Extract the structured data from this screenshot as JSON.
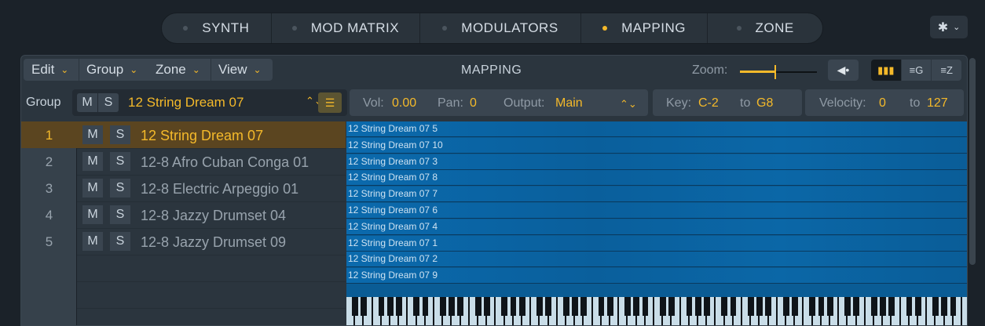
{
  "nav": {
    "tabs": [
      {
        "label": "SYNTH",
        "active": false
      },
      {
        "label": "MOD MATRIX",
        "active": false
      },
      {
        "label": "MODULATORS",
        "active": false
      },
      {
        "label": "MAPPING",
        "active": true
      },
      {
        "label": "ZONE",
        "active": false
      }
    ],
    "settings_icon": "gear-icon"
  },
  "toolbar": {
    "menus": [
      "Edit",
      "Group",
      "Zone",
      "View"
    ],
    "title": "MAPPING",
    "zoom_label": "Zoom:",
    "zoom_level": 0.45
  },
  "group_row": {
    "label": "Group",
    "mute": "M",
    "solo": "S",
    "name": "12 String Dream 07",
    "vol_label": "Vol:",
    "vol_value": "0.00",
    "pan_label": "Pan:",
    "pan_value": "0",
    "output_label": "Output:",
    "output_value": "Main",
    "key_label": "Key:",
    "key_low": "C-2",
    "key_to": "to",
    "key_high": "G8",
    "vel_label": "Velocity:",
    "vel_low": "0",
    "vel_to": "to",
    "vel_high": "127"
  },
  "zones": [
    {
      "num": "1",
      "m": "M",
      "s": "S",
      "name": "12 String Dream 07",
      "selected": true
    },
    {
      "num": "2",
      "m": "M",
      "s": "S",
      "name": "12-8 Afro Cuban Conga 01",
      "selected": false
    },
    {
      "num": "3",
      "m": "M",
      "s": "S",
      "name": "12-8 Electric Arpeggio 01",
      "selected": false
    },
    {
      "num": "4",
      "m": "M",
      "s": "S",
      "name": "12-8 Jazzy Drumset 04",
      "selected": false
    },
    {
      "num": "5",
      "m": "M",
      "s": "S",
      "name": "12-8 Jazzy Drumset 09",
      "selected": false
    }
  ],
  "mapping_rows": [
    "12 String Dream 07 5",
    "12 String Dream 07 10",
    "12 String Dream 07 3",
    "12 String Dream 07 8",
    "12 String Dream 07 7",
    "12 String Dream 07 6",
    "12 String Dream 07 4",
    "12 String Dream 07 1",
    "12 String Dream 07 2",
    "12 String Dream 07 9"
  ],
  "colors": {
    "accent": "#f4b92a",
    "zone_blue": "#0b6aad",
    "selected_row": "#5b4520"
  }
}
